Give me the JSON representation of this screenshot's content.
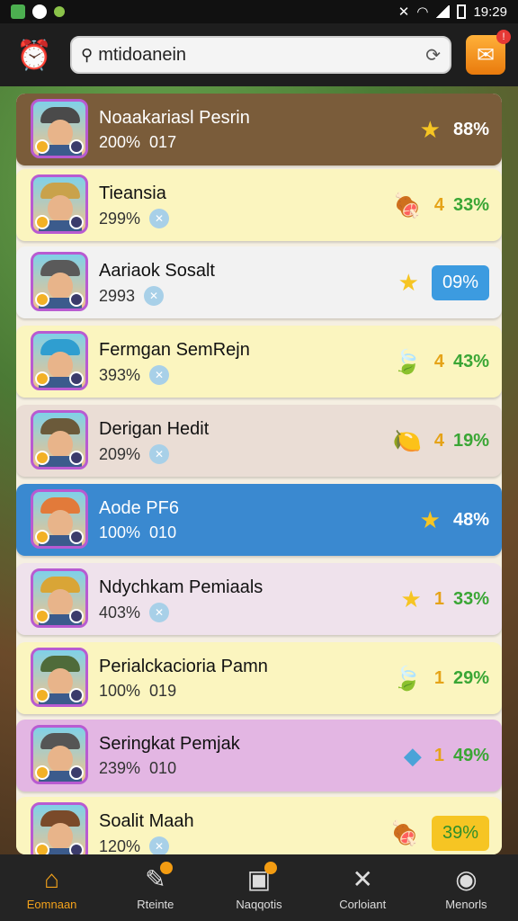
{
  "status_bar": {
    "time": "19:29"
  },
  "header": {
    "search_value": "mtidoanein",
    "notification_badge": "!"
  },
  "rows": [
    {
      "name": "Noaakariasl Pesrin",
      "sub": "200%",
      "sub2": "017",
      "right_text": "88%",
      "bg": "#7a5c3a",
      "name_color": "#ffffff",
      "hat": "#4a4a4a",
      "icon": "star",
      "badge_style": "plain"
    },
    {
      "name": "Tieansia",
      "sub": "299%",
      "sub2": "",
      "right_text": "33%",
      "digit": "4",
      "bg": "#fbf5bf",
      "name_color": "#111111",
      "hat": "#c9a24b",
      "icon": "meat",
      "badge_style": "plain"
    },
    {
      "name": "Aariaok Sosalt",
      "sub": "2993",
      "sub2": "",
      "right_text": "09%",
      "bg": "#f2f2f2",
      "name_color": "#111111",
      "hat": "#5a5a5a",
      "icon": "star",
      "badge_style": "blue"
    },
    {
      "name": "Fermgan SemRejn",
      "sub": "393%",
      "sub2": "",
      "right_text": "43%",
      "digit": "4",
      "bg": "#fbf5bf",
      "name_color": "#111111",
      "hat": "#2f9ed0",
      "icon": "leaf",
      "badge_style": "plain"
    },
    {
      "name": "Derigan Hedit",
      "sub": "209%",
      "sub2": "",
      "right_text": "19%",
      "digit": "4",
      "bg": "#eaddd5",
      "name_color": "#111111",
      "hat": "#6b5a3a",
      "icon": "fruit",
      "badge_style": "plain"
    },
    {
      "name": "Aode PF6",
      "sub": "100%",
      "sub2": "010",
      "right_text": "48%",
      "bg": "#3a89d0",
      "name_color": "#ffffff",
      "hat": "#e27a3a",
      "icon": "star",
      "badge_style": "plain"
    },
    {
      "name": "Ndychkam Pemiaals",
      "sub": "403%",
      "sub2": "",
      "right_text": "33%",
      "digit": "1",
      "bg": "#efe2ec",
      "name_color": "#111111",
      "hat": "#d9a536",
      "icon": "star",
      "badge_style": "plain"
    },
    {
      "name": "Perialckacioria Pamn",
      "sub": "100%",
      "sub2": "019",
      "right_text": "29%",
      "digit": "1",
      "bg": "#fbf5bf",
      "name_color": "#111111",
      "hat": "#4f6b3a",
      "icon": "leaf",
      "badge_style": "plain"
    },
    {
      "name": "Seringkat Pemjak",
      "sub": "239%",
      "sub2": "010",
      "right_text": "49%",
      "digit": "1",
      "bg": "#e3b6e3",
      "name_color": "#111111",
      "hat": "#555555",
      "icon": "crystal",
      "badge_style": "plain"
    },
    {
      "name": "Soalit Maah",
      "sub": "120%",
      "sub2": "",
      "right_text": "39%",
      "bg": "#fbf5bf",
      "name_color": "#111111",
      "hat": "#7a4a2a",
      "icon": "meat",
      "badge_style": "yellow"
    }
  ],
  "tabs": [
    {
      "label": "Eomnaan",
      "active": true
    },
    {
      "label": "Rteinte",
      "active": false
    },
    {
      "label": "Naqqotis",
      "active": false
    },
    {
      "label": "Corloiant",
      "active": false
    },
    {
      "label": "Menorls",
      "active": false
    }
  ],
  "colors": {
    "accent": "#f3a21b",
    "green_value": "#3aa635"
  }
}
